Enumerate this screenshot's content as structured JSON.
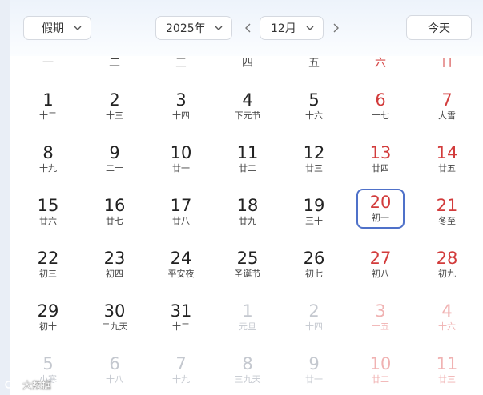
{
  "toolbar": {
    "holiday_label": "假期",
    "year_label": "2025年",
    "month_label": "12月",
    "today_label": "今天"
  },
  "weekdays": [
    "一",
    "二",
    "三",
    "四",
    "五",
    "六",
    "日"
  ],
  "weeks": [
    [
      {
        "day": "1",
        "lunar": "十二",
        "other": false
      },
      {
        "day": "2",
        "lunar": "十三",
        "other": false
      },
      {
        "day": "3",
        "lunar": "十四",
        "other": false
      },
      {
        "day": "4",
        "lunar": "下元节",
        "other": false
      },
      {
        "day": "5",
        "lunar": "十六",
        "other": false
      },
      {
        "day": "6",
        "lunar": "十七",
        "other": false
      },
      {
        "day": "7",
        "lunar": "大雪",
        "other": false
      }
    ],
    [
      {
        "day": "8",
        "lunar": "十九",
        "other": false
      },
      {
        "day": "9",
        "lunar": "二十",
        "other": false
      },
      {
        "day": "10",
        "lunar": "廿一",
        "other": false
      },
      {
        "day": "11",
        "lunar": "廿二",
        "other": false
      },
      {
        "day": "12",
        "lunar": "廿三",
        "other": false
      },
      {
        "day": "13",
        "lunar": "廿四",
        "other": false
      },
      {
        "day": "14",
        "lunar": "廿五",
        "other": false
      }
    ],
    [
      {
        "day": "15",
        "lunar": "廿六",
        "other": false
      },
      {
        "day": "16",
        "lunar": "廿七",
        "other": false
      },
      {
        "day": "17",
        "lunar": "廿八",
        "other": false
      },
      {
        "day": "18",
        "lunar": "廿九",
        "other": false
      },
      {
        "day": "19",
        "lunar": "三十",
        "other": false
      },
      {
        "day": "20",
        "lunar": "初一",
        "other": false,
        "selected": true
      },
      {
        "day": "21",
        "lunar": "冬至",
        "other": false
      }
    ],
    [
      {
        "day": "22",
        "lunar": "初三",
        "other": false
      },
      {
        "day": "23",
        "lunar": "初四",
        "other": false
      },
      {
        "day": "24",
        "lunar": "平安夜",
        "other": false
      },
      {
        "day": "25",
        "lunar": "圣诞节",
        "other": false
      },
      {
        "day": "26",
        "lunar": "初七",
        "other": false
      },
      {
        "day": "27",
        "lunar": "初八",
        "other": false
      },
      {
        "day": "28",
        "lunar": "初九",
        "other": false
      }
    ],
    [
      {
        "day": "29",
        "lunar": "初十",
        "other": false
      },
      {
        "day": "30",
        "lunar": "二九天",
        "other": false
      },
      {
        "day": "31",
        "lunar": "十二",
        "other": false
      },
      {
        "day": "1",
        "lunar": "元旦",
        "other": true
      },
      {
        "day": "2",
        "lunar": "十四",
        "other": true
      },
      {
        "day": "3",
        "lunar": "十五",
        "other": true
      },
      {
        "day": "4",
        "lunar": "十六",
        "other": true
      }
    ],
    [
      {
        "day": "5",
        "lunar": "小寒",
        "other": true
      },
      {
        "day": "6",
        "lunar": "十八",
        "other": true
      },
      {
        "day": "7",
        "lunar": "十九",
        "other": true
      },
      {
        "day": "8",
        "lunar": "三九天",
        "other": true
      },
      {
        "day": "9",
        "lunar": "廿一",
        "other": true
      },
      {
        "day": "10",
        "lunar": "廿二",
        "other": true
      },
      {
        "day": "11",
        "lunar": "廿三",
        "other": true
      }
    ]
  ],
  "watermark": {
    "text": "大数据",
    "icon": "brand-logo-icon"
  },
  "colors": {
    "weekend": "#d23b3b",
    "selected_border": "#4f71c9",
    "other_month": "#c4c8cf"
  }
}
